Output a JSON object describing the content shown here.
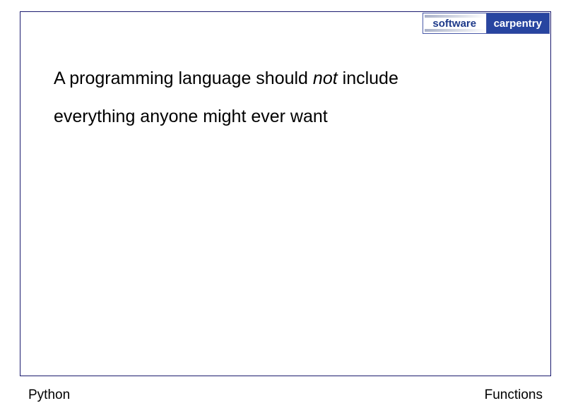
{
  "logo": {
    "left": "software",
    "right": "carpentry"
  },
  "content": {
    "line1_part1": "A programming language should ",
    "line1_emphasis": "not",
    "line1_part2": " include",
    "line2": "everything anyone might ever want"
  },
  "footer": {
    "left": "Python",
    "right": "Functions"
  }
}
